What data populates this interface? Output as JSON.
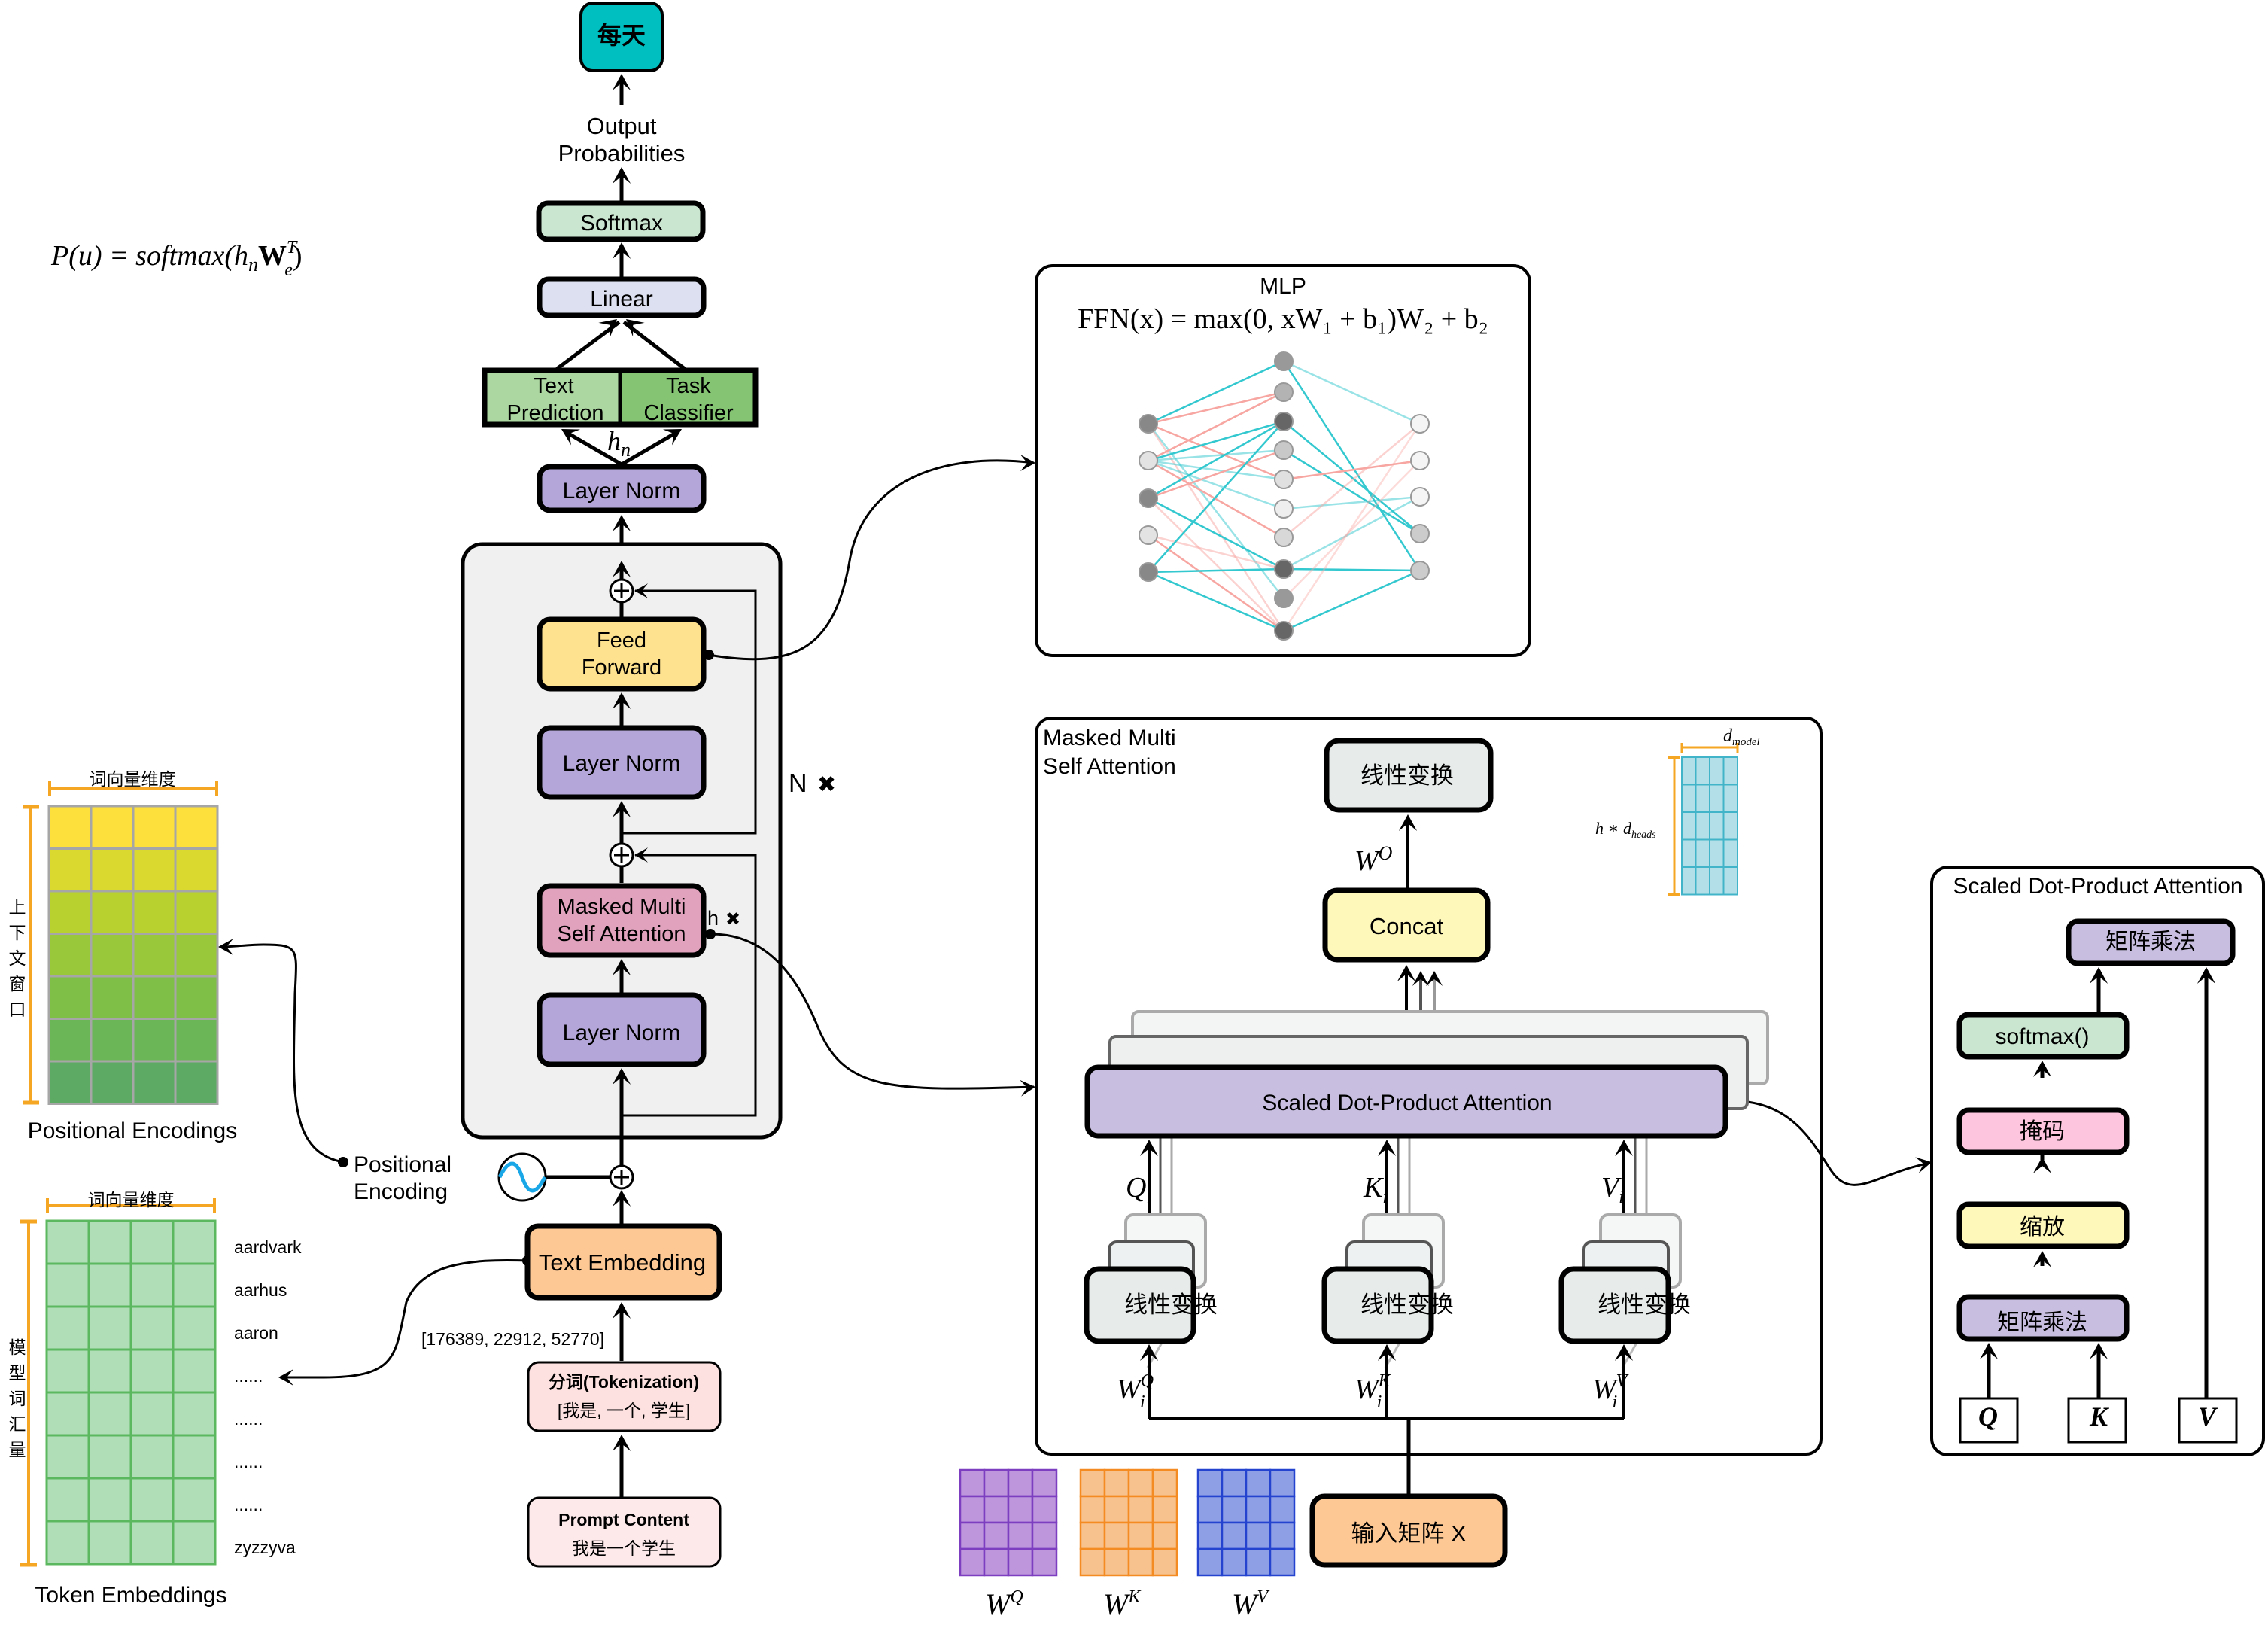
{
  "output": {
    "token": "每天",
    "probabilities_label_1": "Output",
    "probabilities_label_2": "Probabilities"
  },
  "formula_output": "P(u) = softmax(h",
  "formula_output_parts": {
    "lhs": "P(u) = softmax(",
    "h": "h",
    "n": "n",
    "W": "W",
    "T": "T",
    "e": "e",
    "close": ")"
  },
  "head": {
    "softmax": "Softmax",
    "linear": "Linear",
    "text_prediction_1": "Text",
    "text_prediction_2": "Prediction",
    "task_classifier_1": "Task",
    "task_classifier_2": "Classifier",
    "hn_h": "h",
    "hn_n": "n",
    "final_layer_norm": "Layer Norm"
  },
  "block": {
    "feed_forward_1": "Feed",
    "feed_forward_2": "Forward",
    "layer_norm_2": "Layer Norm",
    "masked_attn_1": "Masked Multi",
    "masked_attn_2": "Self Attention",
    "layer_norm_1": "Layer Norm",
    "repeat_n": "N",
    "repeat_h": "h",
    "times": "✖"
  },
  "embedding": {
    "positional_label_1": "Positional",
    "positional_label_2": "Encoding",
    "text_embedding": "Text Embedding",
    "token_ids": "[176389, 22912, 52770]",
    "tokenization_title": "分词(Tokenization)",
    "tokenization_tokens": "[我是, 一个, 学生]",
    "prompt_title": "Prompt Content",
    "prompt_text": "我是一个学生"
  },
  "positional_encodings": {
    "title": "Positional Encodings",
    "width_label": "词向量维度",
    "height_label": [
      "上",
      "下",
      "文",
      "窗",
      "口"
    ],
    "row_colors": [
      "#fde03c",
      "#dad92f",
      "#b8d12f",
      "#99c83a",
      "#80bf47",
      "#6bb656",
      "#5caa63"
    ]
  },
  "token_embeddings": {
    "title": "Token Embeddings",
    "width_label": "词向量维度",
    "height_label": [
      "模",
      "型",
      "词",
      "汇",
      "量"
    ],
    "vocab": [
      "aardvark",
      "aarhus",
      "aaron",
      "......",
      "......",
      "......",
      "......",
      "zyzzyva"
    ],
    "cell_color": "#b0deb7",
    "grid_color": "#5cb85f"
  },
  "mlp": {
    "title": "MLP",
    "formula": "FFN(x) = max(0, xW₁ + b₁)W₂ + b₂"
  },
  "mha": {
    "title_1": "Masked Multi",
    "title_2": "Self Attention",
    "linear_top": "线性变换",
    "wo_W": "W",
    "wo_O": "O",
    "concat": "Concat",
    "sdpa": "Scaled Dot-Product Attention",
    "q_label": "Q",
    "k_label": "K",
    "v_label": "V",
    "sub_i": "i",
    "linear_q": "线性变换",
    "linear_k": "线性变换",
    "linear_v": "线性变换",
    "wq_sup": "Q",
    "wk_sup": "K",
    "wv_sup": "V",
    "d_model_d": "d",
    "d_model_sub": "model",
    "h_dheads": "h ∗ d",
    "h_dheads_sub": "heads"
  },
  "input_matrix": {
    "label": "输入矩阵 X"
  },
  "weight_matrices": [
    {
      "name": "W",
      "sup": "Q",
      "fill": "#bd96dc",
      "stroke": "#7d3fc0"
    },
    {
      "name": "W",
      "sup": "K",
      "fill": "#f8c28e",
      "stroke": "#f38a22"
    },
    {
      "name": "W",
      "sup": "V",
      "fill": "#8e9fe6",
      "stroke": "#2443cf"
    }
  ],
  "sdpa_panel": {
    "title": "Scaled Dot-Product Attention",
    "matmul_top": "矩阵乘法",
    "softmax": "softmax()",
    "mask": "掩码",
    "scale": "缩放",
    "matmul_bottom": "矩阵乘法",
    "q": "Q",
    "k": "K",
    "v": "V"
  },
  "colors": {
    "output_token": "#00bfc0",
    "softmax": "#cbe6d0",
    "linear": "#dde0f0",
    "text_prediction": "#acd7a0",
    "task_classifier": "#84c473",
    "layer_norm": "#b5a6d9",
    "feed_forward": "#fee28f",
    "masked_attention": "#e0a2bc",
    "block_bg": "#f0f0f0",
    "text_embedding": "#fdc894",
    "tokenization": "#fde0e0",
    "prompt": "#fde8ea",
    "linear_transform": "#e7ecea",
    "concat": "#fef8bb",
    "sdpa": "#c8bfe0",
    "mask": "#fec5de",
    "scale": "#fef8bb",
    "softmax_panel": "#cbe6d0",
    "matmul": "#c8bfe0",
    "input_matrix": "#fdc894",
    "dmodel_grid": "#b2dfe8",
    "dmodel_grid_stroke": "#42b4c9",
    "orange_bracket": "#f5a623",
    "sine": "#1aa7e8",
    "cyan_edge": "#33c8cf",
    "pink_edge": "#f7a6a1"
  }
}
